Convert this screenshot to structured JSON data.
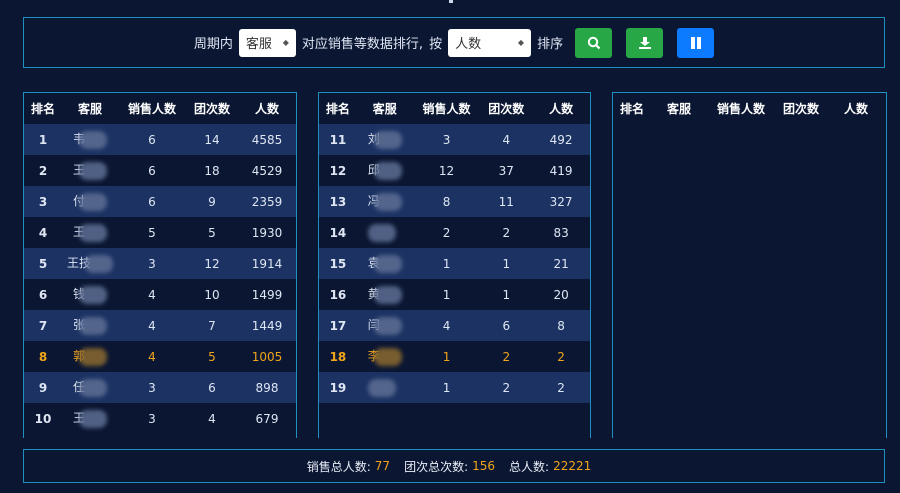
{
  "toolbar": {
    "period_label": "周期内",
    "select1_value": "客服",
    "middle_text": "对应销售等数据排行,",
    "by_label": "按",
    "select2_value": "人数",
    "sort_label": "排序",
    "search_color": "#27a745",
    "download_color": "#27a745",
    "pause_color": "#0d7bff"
  },
  "headers": [
    "排名",
    "客服",
    "销售人数",
    "团次数",
    "人数"
  ],
  "panels": [
    {
      "rows": [
        {
          "rank": "1",
          "name": "韦",
          "sales": "6",
          "groups": "14",
          "people": "4585"
        },
        {
          "rank": "2",
          "name": "王",
          "sales": "6",
          "groups": "18",
          "people": "4529"
        },
        {
          "rank": "3",
          "name": "付",
          "sales": "6",
          "groups": "9",
          "people": "2359"
        },
        {
          "rank": "4",
          "name": "王",
          "sales": "5",
          "groups": "5",
          "people": "1930"
        },
        {
          "rank": "5",
          "name": "王技",
          "sales": "3",
          "groups": "12",
          "people": "1914"
        },
        {
          "rank": "6",
          "name": "钱",
          "sales": "4",
          "groups": "10",
          "people": "1499"
        },
        {
          "rank": "7",
          "name": "张",
          "sales": "4",
          "groups": "7",
          "people": "1449"
        },
        {
          "rank": "8",
          "name": "郭",
          "sales": "4",
          "groups": "5",
          "people": "1005"
        },
        {
          "rank": "9",
          "name": "任",
          "sales": "3",
          "groups": "6",
          "people": "898"
        },
        {
          "rank": "10",
          "name": "王",
          "sales": "3",
          "groups": "4",
          "people": "679"
        }
      ]
    },
    {
      "rows": [
        {
          "rank": "11",
          "name": "刘",
          "sales": "3",
          "groups": "4",
          "people": "492"
        },
        {
          "rank": "12",
          "name": "邱",
          "sales": "12",
          "groups": "37",
          "people": "419"
        },
        {
          "rank": "13",
          "name": "冯",
          "sales": "8",
          "groups": "11",
          "people": "327"
        },
        {
          "rank": "14",
          "name": "",
          "sales": "2",
          "groups": "2",
          "people": "83"
        },
        {
          "rank": "15",
          "name": "袁",
          "sales": "1",
          "groups": "1",
          "people": "21"
        },
        {
          "rank": "16",
          "name": "黄",
          "sales": "1",
          "groups": "1",
          "people": "20"
        },
        {
          "rank": "17",
          "name": "闫",
          "sales": "4",
          "groups": "6",
          "people": "8"
        },
        {
          "rank": "18",
          "name": "李",
          "sales": "1",
          "groups": "2",
          "people": "2"
        },
        {
          "rank": "19",
          "name": "",
          "sales": "1",
          "groups": "2",
          "people": "2"
        }
      ]
    },
    {
      "rows": []
    }
  ],
  "highlight_rank": [
    "8",
    "18"
  ],
  "highlight_color": "#f0a51a",
  "footer": {
    "sales_label": "销售总人数:",
    "sales_value": "77",
    "groups_label": "团次总次数:",
    "groups_value": "156",
    "people_label": "总人数:",
    "people_value": "22221"
  }
}
